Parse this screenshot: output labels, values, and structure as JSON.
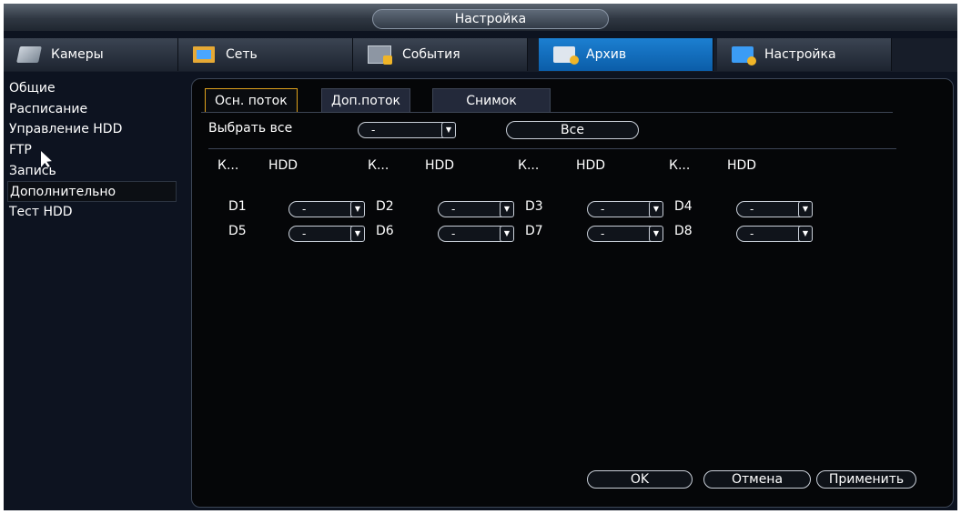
{
  "window": {
    "title": "Настройка"
  },
  "tabs": [
    {
      "label": "Камеры",
      "icon": "camera-icon"
    },
    {
      "label": "Сеть",
      "icon": "network-icon"
    },
    {
      "label": "События",
      "icon": "events-icon"
    },
    {
      "label": "Архив",
      "icon": "archive-icon"
    },
    {
      "label": "Настройка",
      "icon": "settings-icon"
    }
  ],
  "sidebar": {
    "items": [
      {
        "label": "Общие"
      },
      {
        "label": "Расписание"
      },
      {
        "label": "Управление HDD"
      },
      {
        "label": "FTP"
      },
      {
        "label": "Запись"
      },
      {
        "label": "Дополнительно"
      },
      {
        "label": "Тест HDD"
      }
    ]
  },
  "subtabs": [
    {
      "label": "Осн. поток"
    },
    {
      "label": "Доп.поток"
    },
    {
      "label": "Снимок"
    }
  ],
  "select_all": {
    "label": "Выбрать все",
    "value": "-",
    "all_button": "Все"
  },
  "headers": {
    "channel": "К...",
    "hdd": "HDD"
  },
  "channels": [
    {
      "name": "D1",
      "value": "-"
    },
    {
      "name": "D2",
      "value": "-"
    },
    {
      "name": "D3",
      "value": "-"
    },
    {
      "name": "D4",
      "value": "-"
    },
    {
      "name": "D5",
      "value": "-"
    },
    {
      "name": "D6",
      "value": "-"
    },
    {
      "name": "D7",
      "value": "-"
    },
    {
      "name": "D8",
      "value": "-"
    }
  ],
  "buttons": {
    "ok": "OK",
    "cancel": "Отмена",
    "apply": "Применить"
  },
  "colors": {
    "accent": "#1c7fd1",
    "tab_active_border": "#e0a21c",
    "background": "#0d1320"
  }
}
